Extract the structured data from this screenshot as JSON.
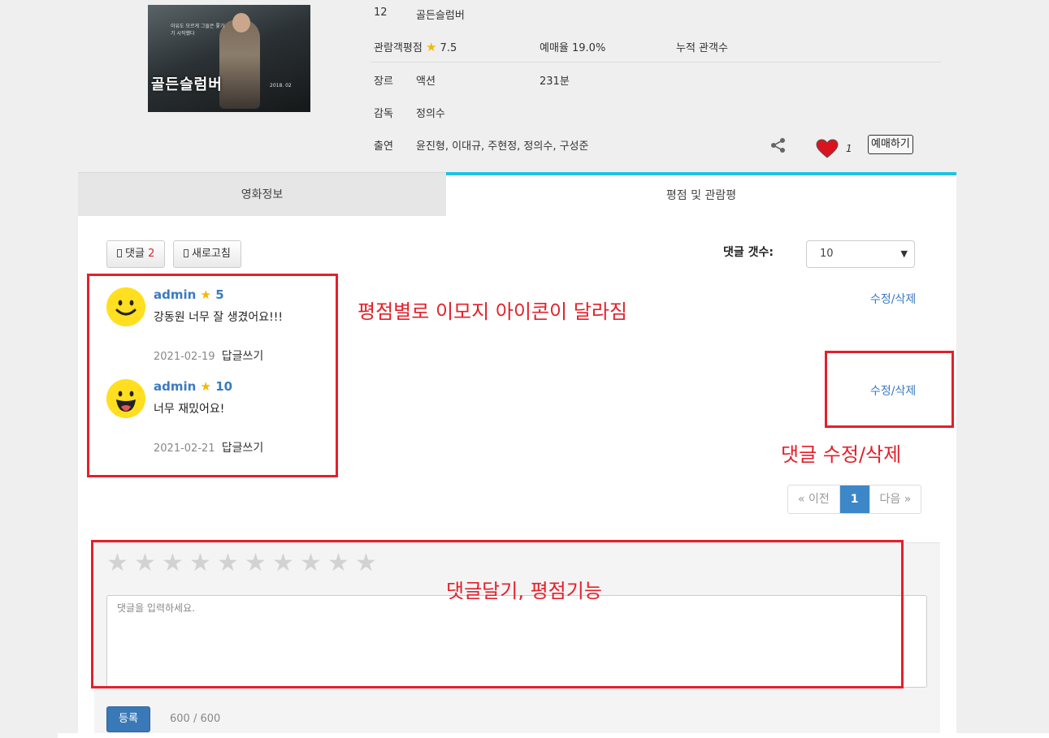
{
  "movie": {
    "rating_age": "12",
    "title": "골든슬럼버",
    "poster": {
      "title": "골든슬럼버",
      "tagline": "이유도 모르게 그들은 쫓기기 시작했다",
      "date": "2018. 02"
    },
    "audience_label": "관람객평점",
    "audience_score": "7.5",
    "reservation": "예매율 19.0%",
    "cumulative_label": "누적 관객수",
    "genre_label": "장르",
    "genre_value": "액션",
    "runtime": "231분",
    "director_label": "감독",
    "director_value": "정의수",
    "cast_label": "출연",
    "cast_value": "윤진형, 이대규, 주현정, 정의수, 구성준",
    "like_count": "1",
    "book_button": "예매하기"
  },
  "tabs": {
    "info": "영화정보",
    "review": "평점 및 관람평"
  },
  "toolbar": {
    "comments_label": "댓글",
    "comments_count": "2",
    "refresh_label": "새로고침",
    "count_label": "댓글 갯수:",
    "count_selected": "10"
  },
  "comments": [
    {
      "user": "admin",
      "score": "5",
      "text": "강동원 너무 잘 생겼어요!!!",
      "date": "2021-02-19",
      "reply": "답글쓰기",
      "edit": "수정/삭제",
      "emoji": "smile-face-icon"
    },
    {
      "user": "admin",
      "score": "10",
      "text": "너무 재밌어요!",
      "date": "2021-02-21",
      "reply": "답글쓰기",
      "edit": "수정/삭제",
      "emoji": "grin-face-icon"
    }
  ],
  "pagination": {
    "prev": "« 이전",
    "current": "1",
    "next": "다음 »"
  },
  "form": {
    "stars_total": 10,
    "placeholder": "댓글을 입력하세요.",
    "submit": "등록",
    "char_count": "600 / 600"
  },
  "annotations": {
    "emoji_note": "평점별로 이모지 아이콘이 달라짐",
    "edit_note": "댓글 수정/삭제",
    "form_note": "댓글달기, 평점기능"
  },
  "colors": {
    "accent": "#1ec3e0",
    "link": "#3b7bbf",
    "annotation": "#e3202b",
    "emoji": "#ffdf1f"
  }
}
